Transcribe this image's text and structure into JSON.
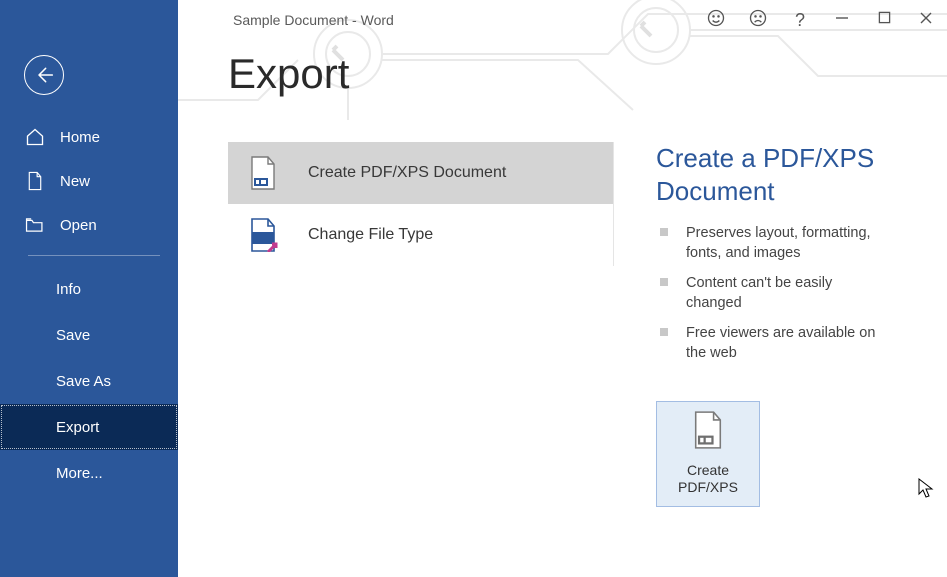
{
  "titlebar": {
    "doc_title": "Sample Document  -  Word"
  },
  "sidebar": {
    "items": [
      {
        "label": "Home"
      },
      {
        "label": "New"
      },
      {
        "label": "Open"
      }
    ],
    "sub_items": [
      {
        "label": "Info"
      },
      {
        "label": "Save"
      },
      {
        "label": "Save As"
      },
      {
        "label": "Export"
      },
      {
        "label": "More..."
      }
    ]
  },
  "page": {
    "heading": "Export"
  },
  "options": [
    {
      "label": "Create PDF/XPS Document"
    },
    {
      "label": "Change File Type"
    }
  ],
  "details": {
    "title": "Create a PDF/XPS Document",
    "bullets": [
      "Preserves layout, formatting, fonts, and images",
      "Content can't be easily changed",
      "Free viewers are available on the web"
    ],
    "button_line1": "Create",
    "button_line2": "PDF/XPS"
  }
}
